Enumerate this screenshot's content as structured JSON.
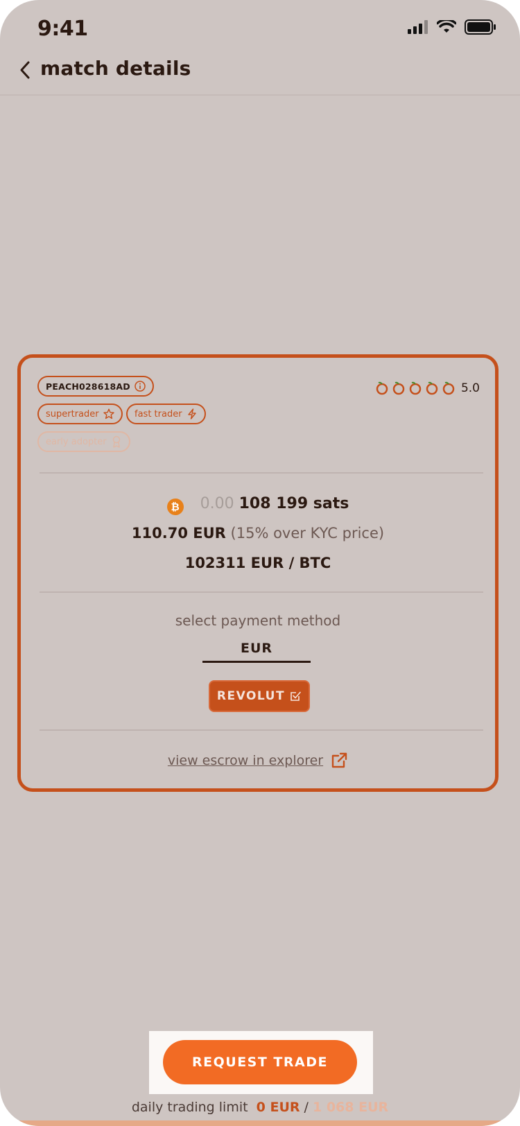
{
  "status_bar": {
    "time": "9:41"
  },
  "header": {
    "title": "match details"
  },
  "card": {
    "peach_id": "PEACH028618AD",
    "badges": [
      "supertrader",
      "fast trader",
      "early adopter"
    ],
    "rating": {
      "value": "5.0",
      "stars": 5,
      "max": 5
    },
    "amount": {
      "btc_prefix": "0.00",
      "sats": "108 199 sats"
    },
    "price": {
      "value": "110.70 EUR",
      "premium": "(15% over KYC price)"
    },
    "rate": "102311 EUR / BTC",
    "payment": {
      "label": "select payment method",
      "currency": "EUR",
      "method": "REVOLUT"
    },
    "escrow_link": "view escrow in explorer"
  },
  "cta": {
    "label": "REQUEST TRADE"
  },
  "limit": {
    "label": "daily trading limit",
    "used": "0 EUR",
    "separator": "/",
    "max": "1 068 EUR"
  },
  "colors": {
    "accent": "#c5501b",
    "cta": "#f26b24",
    "background": "#cec5c2",
    "text": "#2b1911"
  }
}
